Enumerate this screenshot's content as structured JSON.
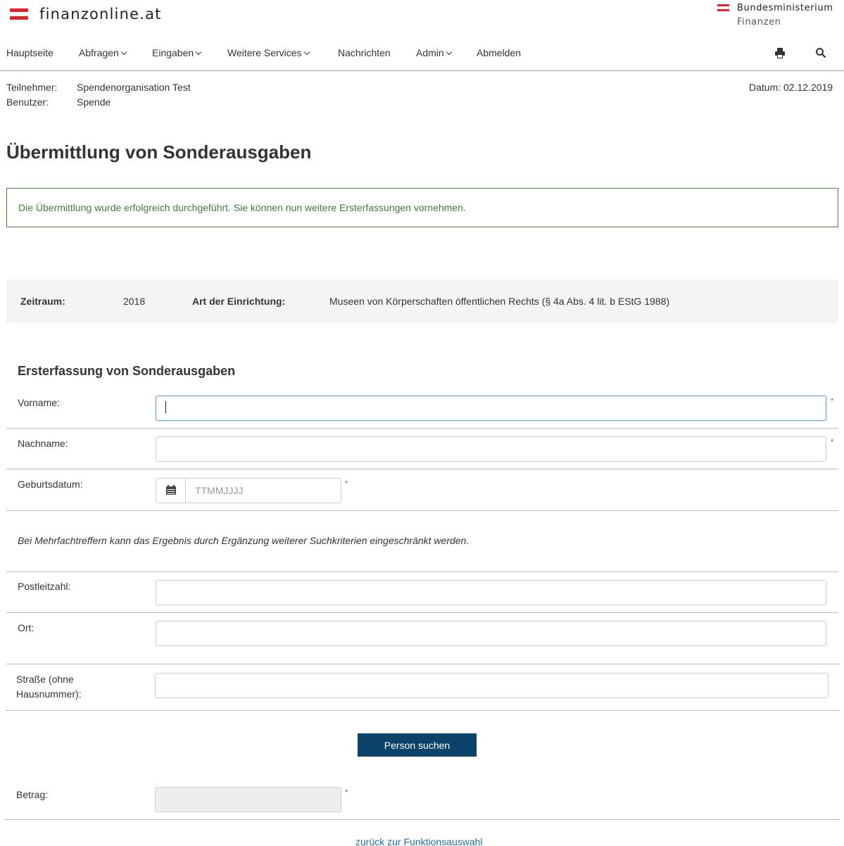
{
  "brand": {
    "logo_text": "finanzonline.at",
    "ministry_line1": "Bundesministerium",
    "ministry_line2": "Finanzen",
    "accent_color": "#e4202c"
  },
  "nav": {
    "items": [
      {
        "label": "Hauptseite",
        "dropdown": false
      },
      {
        "label": "Abfragen",
        "dropdown": true
      },
      {
        "label": "Eingaben",
        "dropdown": true
      },
      {
        "label": "Weitere Services",
        "dropdown": true
      },
      {
        "label": "Nachrichten",
        "dropdown": false
      },
      {
        "label": "Admin",
        "dropdown": true
      },
      {
        "label": "Abmelden",
        "dropdown": false
      }
    ],
    "icons": [
      "print-icon",
      "search-icon"
    ]
  },
  "user": {
    "participant_label": "Teilnehmer:",
    "participant_value": "Spendenorganisation Test",
    "user_label": "Benutzer:",
    "user_value": "Spende",
    "date_text": "Datum: 02.12.2019"
  },
  "page": {
    "title": "Übermittlung von Sonderausgaben",
    "success_message": "Die Übermittlung wurde erfolgreich durchgeführt. Sie können nun weitere Ersterfassungen vornehmen.",
    "success_color": "#3b7d3b"
  },
  "meta": {
    "period_label": "Zeitraum:",
    "period_value": "2018",
    "institution_label": "Art der Einrichtung:",
    "institution_value": "Museen von Körperschaften öffentlichen Rechts (§ 4a Abs. 4 lit. b EStG 1988)"
  },
  "form": {
    "heading": "Ersterfassung von Sonderausgaben",
    "vorname_label": "Vorname:",
    "vorname_value": "",
    "nachname_label": "Nachname:",
    "nachname_value": "",
    "geburtsdatum_label": "Geburtsdatum:",
    "geburtsdatum_placeholder": "TTMMJJJJ",
    "required_marker": "*",
    "hint": "Bei Mehrfachtreffern kann das Ergebnis durch Ergänzung weiterer Suchkriterien eingeschränkt werden.",
    "plz_label": "Postleitzahl:",
    "ort_label": "Ort:",
    "strasse_label_1": "Straße (ohne",
    "strasse_label_2": "Hausnummer):",
    "search_button": "Person suchen",
    "betrag_label": "Betrag:",
    "button_color": "#0a4269"
  },
  "footer": {
    "back_link": "zurück zur Funktionsauswahl"
  }
}
